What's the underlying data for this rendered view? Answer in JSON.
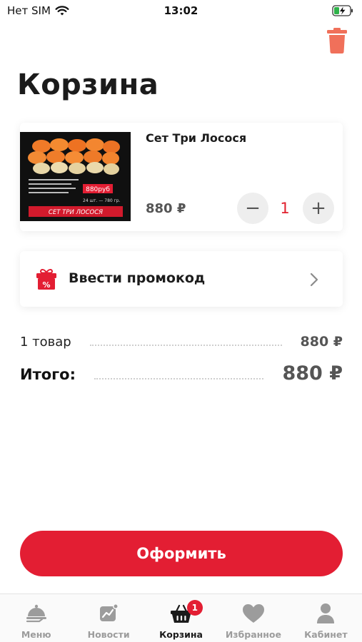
{
  "status_bar": {
    "carrier": "Нет SIM",
    "time": "13:02"
  },
  "colors": {
    "accent": "#e31e33",
    "trash": "#f0705a",
    "muted": "#555555",
    "tab_inactive": "#9c9c9c"
  },
  "page": {
    "title": "Корзина"
  },
  "cart": {
    "items": [
      {
        "name": "Сет Три Лосося",
        "price": "880 ₽",
        "quantity": "1",
        "image": {
          "price_tag": "880руб",
          "weight": "24 шт. — 780 гр.",
          "banner": "СЕТ ТРИ ЛОСОСЯ"
        }
      }
    ],
    "minus_symbol": "−",
    "plus_symbol": "+"
  },
  "promo": {
    "label": "Ввести промокод",
    "icon": "gift-percent-icon"
  },
  "summary": {
    "items_label": "1 товар",
    "items_value": "880 ₽",
    "total_label": "Итого:",
    "total_value": "880 ₽"
  },
  "checkout": {
    "label": "Оформить"
  },
  "tab_bar": {
    "tabs": [
      {
        "label": "Меню",
        "icon": "cloche-icon"
      },
      {
        "label": "Новости",
        "icon": "news-icon"
      },
      {
        "label": "Корзина",
        "icon": "basket-icon",
        "badge": "1",
        "active": true
      },
      {
        "label": "Избранное",
        "icon": "heart-icon"
      },
      {
        "label": "Кабинет",
        "icon": "user-icon"
      }
    ]
  }
}
